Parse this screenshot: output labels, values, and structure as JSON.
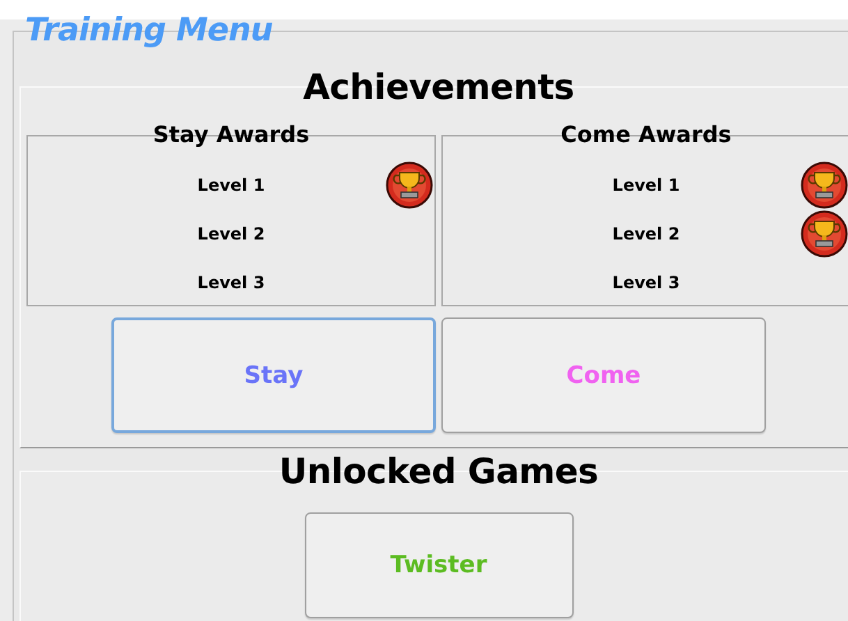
{
  "window": {
    "title": "Training Menu"
  },
  "achievements": {
    "title": "Achievements",
    "groups": [
      {
        "title": "Stay Awards",
        "levels": [
          {
            "label": "Level 1",
            "awarded": true
          },
          {
            "label": "Level 2",
            "awarded": false
          },
          {
            "label": "Level 3",
            "awarded": false
          }
        ]
      },
      {
        "title": "Come Awards",
        "levels": [
          {
            "label": "Level 1",
            "awarded": true
          },
          {
            "label": "Level 2",
            "awarded": true
          },
          {
            "label": "Level 3",
            "awarded": false
          }
        ]
      }
    ],
    "buttons": [
      {
        "label": "Stay",
        "color": "#6a74f8",
        "focused": true
      },
      {
        "label": "Come",
        "color": "#f062f0",
        "focused": false
      }
    ]
  },
  "unlocked_games": {
    "title": "Unlocked Games",
    "buttons": [
      {
        "label": "Twister",
        "color": "#5cbc22",
        "focused": false
      }
    ]
  }
}
